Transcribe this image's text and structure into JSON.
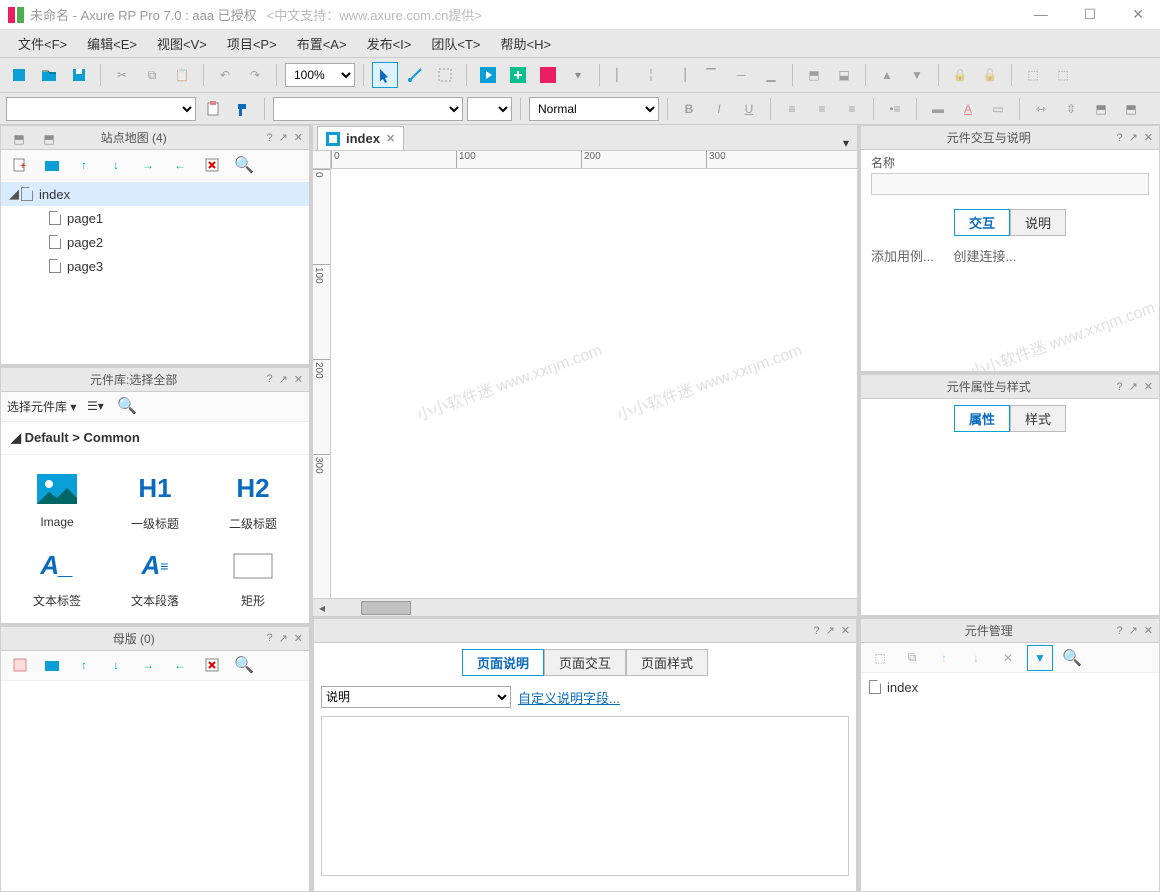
{
  "titlebar": {
    "doc_name": "未命名",
    "app_name": "Axure RP Pro 7.0 : aaa 已授权",
    "support": "<中文支持：www.axure.com.cn提供>"
  },
  "menu": [
    "文件<F>",
    "编辑<E>",
    "视图<V>",
    "项目<P>",
    "布置<A>",
    "发布<I>",
    "团队<T>",
    "帮助<H>"
  ],
  "toolbar": {
    "zoom": "100%",
    "style_value": "Normal"
  },
  "sitemap": {
    "title": "站点地图 (4)",
    "pages": [
      "index",
      "page1",
      "page2",
      "page3"
    ]
  },
  "widgets": {
    "title": "元件库:选择全部",
    "select_label": "选择元件库",
    "category": "Default > Common",
    "items": [
      {
        "name": "Image",
        "glyph": "img"
      },
      {
        "name": "一级标题",
        "glyph": "H1"
      },
      {
        "name": "二级标题",
        "glyph": "H2"
      },
      {
        "name": "文本标签",
        "glyph": "A_"
      },
      {
        "name": "文本段落",
        "glyph": "A≡"
      },
      {
        "name": "矩形",
        "glyph": "rect"
      }
    ]
  },
  "masters": {
    "title": "母版 (0)"
  },
  "canvas": {
    "active_tab": "index",
    "ruler_h": [
      "0",
      "100",
      "200",
      "300"
    ],
    "ruler_v": [
      "0",
      "100",
      "200",
      "300"
    ],
    "watermark": "小小软件迷 www.xxrjm.com"
  },
  "page_notes": {
    "tabs": [
      "页面说明",
      "页面交互",
      "页面样式"
    ],
    "dropdown": "说明",
    "custom_link": "自定义说明字段..."
  },
  "interactions": {
    "title": "元件交互与说明",
    "name_label": "名称",
    "tabs": [
      "交互",
      "说明"
    ],
    "links": [
      "添加用例...",
      "创建连接..."
    ]
  },
  "properties": {
    "title": "元件属性与样式",
    "tabs": [
      "属性",
      "样式"
    ]
  },
  "outline": {
    "title": "元件管理",
    "items": [
      "index"
    ]
  }
}
